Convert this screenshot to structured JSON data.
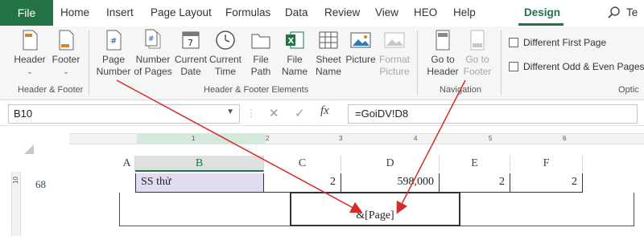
{
  "menu": {
    "file": "File",
    "items": [
      "Home",
      "Insert",
      "Page Layout",
      "Formulas",
      "Data",
      "Review",
      "View",
      "HEO",
      "Help"
    ],
    "design": "Design",
    "search_partial": "Te"
  },
  "ribbon": {
    "header_footer": {
      "header_label": "Header",
      "footer_label": "Footer",
      "group_label": "Header & Footer"
    },
    "elements": {
      "page_number": [
        "Page",
        "Number"
      ],
      "number_of_pages": [
        "Number",
        "of Pages"
      ],
      "current_date": [
        "Current",
        "Date"
      ],
      "current_time": [
        "Current",
        "Time"
      ],
      "file_path": [
        "File",
        "Path"
      ],
      "file_name": [
        "File",
        "Name"
      ],
      "sheet_name": [
        "Sheet",
        "Name"
      ],
      "picture": "Picture",
      "format_picture": [
        "Format",
        "Picture"
      ],
      "group_label": "Header & Footer Elements"
    },
    "navigation": {
      "go_to_header": [
        "Go to",
        "Header"
      ],
      "go_to_footer": [
        "Go to",
        "Footer"
      ],
      "group_label": "Navigation"
    },
    "options": {
      "different_first_page": "Different First Page",
      "different_odd_even": "Different Odd & Even Pages",
      "group_label_partial": "Optic"
    }
  },
  "formula_bar": {
    "name_box": "B10",
    "formula": "=GoiDV!D8",
    "fx": "fx"
  },
  "sheet": {
    "ruler_numbers": [
      "1",
      "2",
      "3",
      "4",
      "5",
      "6"
    ],
    "vruler_number": "10",
    "row_number": "68",
    "columns": [
      "A",
      "B",
      "C",
      "D",
      "E",
      "F"
    ],
    "row": {
      "b": "SS thử",
      "c": "2",
      "d": "598,000",
      "e": "2",
      "f": "2"
    },
    "footer_field": "&[Page]"
  },
  "colors": {
    "accent": "#217346",
    "arrow": "#d62b2b",
    "selected_cell": "#e0ddf0"
  }
}
